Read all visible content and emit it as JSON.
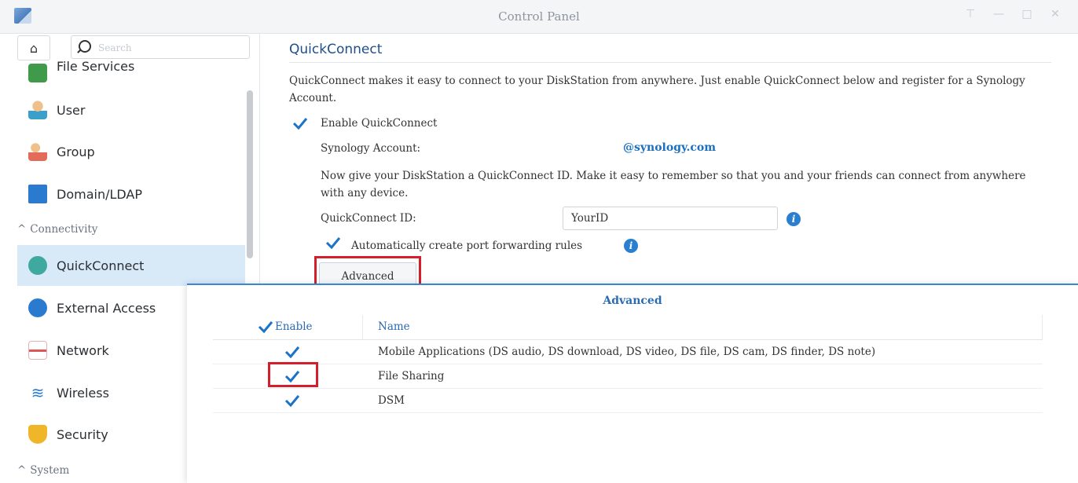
{
  "window": {
    "title": "Control Panel"
  },
  "sidebar": {
    "search_placeholder": "Search",
    "items": [
      {
        "label": "File Services"
      },
      {
        "label": "User"
      },
      {
        "label": "Group"
      },
      {
        "label": "Domain/LDAP"
      }
    ],
    "section_connectivity": "Connectivity",
    "conn_items": [
      {
        "label": "QuickConnect"
      },
      {
        "label": "External Access"
      },
      {
        "label": "Network"
      },
      {
        "label": "Wireless"
      },
      {
        "label": "Security"
      }
    ],
    "section_system": "System"
  },
  "quickconnect": {
    "heading": "QuickConnect",
    "description": "QuickConnect makes it easy to connect to your DiskStation from anywhere. Just enable QuickConnect below and register for a Synology Account.",
    "enable_label": "Enable QuickConnect",
    "account_label": "Synology Account:",
    "account_value": "@synology.com",
    "id_description": "Now give your DiskStation a QuickConnect ID. Make it easy to remember so that you and your friends can connect from anywhere with any device.",
    "id_label": "QuickConnect ID:",
    "id_value": "YourID",
    "port_forward_label": "Automatically create port forwarding rules",
    "advanced_button": "Advanced"
  },
  "advanced_dialog": {
    "title": "Advanced",
    "columns": {
      "enable": "Enable",
      "name": "Name"
    },
    "rows": [
      {
        "name": "Mobile Applications (DS audio, DS download, DS video, DS file, DS cam, DS finder, DS note)",
        "enabled": true
      },
      {
        "name": "File Sharing",
        "enabled": true
      },
      {
        "name": "DSM",
        "enabled": true
      }
    ]
  },
  "colors": {
    "accent": "#1f4f8a",
    "link": "#1a6fbf",
    "highlight": "#d21f2b",
    "selected": "#d8e9f8"
  }
}
